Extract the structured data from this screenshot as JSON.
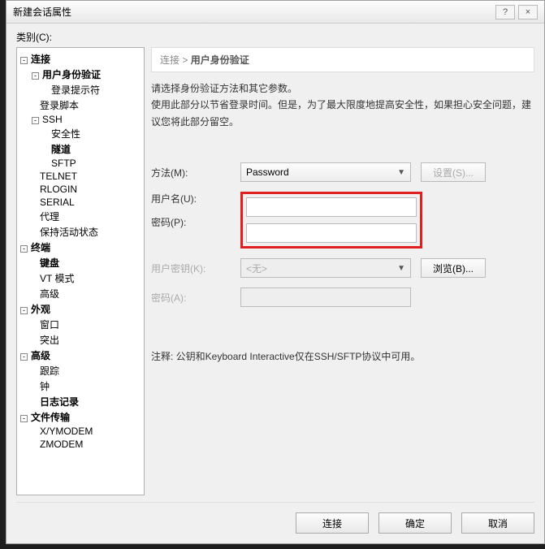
{
  "window": {
    "title": "新建会话属性",
    "help": "?",
    "close": "×"
  },
  "category_label": "类别(C):",
  "tree": {
    "connection": "连接",
    "user_auth": "用户身份验证",
    "login_prompt": "登录提示符",
    "login_script": "登录脚本",
    "ssh": "SSH",
    "security": "安全性",
    "tunnel": "隧道",
    "sftp": "SFTP",
    "telnet": "TELNET",
    "rlogin": "RLOGIN",
    "serial": "SERIAL",
    "proxy": "代理",
    "keep_alive": "保持活动状态",
    "terminal": "终端",
    "keyboard": "键盘",
    "vt_mode": "VT 模式",
    "advanced_terminal": "高级",
    "appearance": "外观",
    "window": "窗口",
    "highlight": "突出",
    "advanced": "高级",
    "trace": "跟踪",
    "bell": "钟",
    "logging": "日志记录",
    "file_transfer": "文件传输",
    "xymodem": "X/YMODEM",
    "zmodem": "ZMODEM"
  },
  "breadcrumb": {
    "root": "连接",
    "sep": ">",
    "current": "用户身份验证"
  },
  "description": {
    "line1": "请选择身份验证方法和其它参数。",
    "line2": "使用此部分以节省登录时间。但是，为了最大限度地提高安全性，如果担心安全问题，建议您将此部分留空。"
  },
  "form": {
    "method_label": "方法(M):",
    "method_value": "Password",
    "settings_btn": "设置(S)...",
    "username_label": "用户名(U):",
    "username_value": "",
    "password_label": "密码(P):",
    "password_value": "",
    "userkey_label": "用户密钥(K):",
    "userkey_value": "<无>",
    "browse_btn": "浏览(B)...",
    "passphrase_label": "密码(A):",
    "passphrase_value": ""
  },
  "note": "注释: 公钥和Keyboard Interactive仅在SSH/SFTP协议中可用。",
  "footer": {
    "connect": "连接",
    "ok": "确定",
    "cancel": "取消"
  },
  "toggle": "-"
}
